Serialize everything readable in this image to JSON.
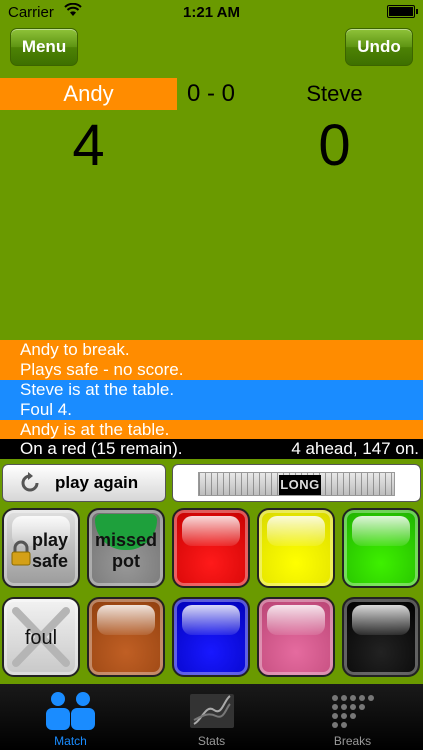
{
  "status": {
    "carrier": "Carrier",
    "time": "1:21 AM"
  },
  "nav": {
    "menu": "Menu",
    "undo": "Undo"
  },
  "players": {
    "left": {
      "name": "Andy",
      "score": "4"
    },
    "right": {
      "name": "Steve",
      "score": "0"
    },
    "frames": "0 - 0"
  },
  "log": [
    {
      "text": "Andy to break.",
      "color": "orange"
    },
    {
      "text": "Plays safe - no score.",
      "color": "orange"
    },
    {
      "text": "Steve is at the table.",
      "color": "blue"
    },
    {
      "text": "Foul 4.",
      "color": "blue"
    },
    {
      "text": "Andy is at the table.",
      "color": "orange"
    }
  ],
  "status_line": {
    "left": "On a red (15 remain).",
    "right": "4 ahead, 147 on."
  },
  "controls": {
    "play_again": "play again",
    "shot_length": "LONG"
  },
  "buttons": {
    "play_safe_line1": "play",
    "play_safe_line2": "safe",
    "missed_pot_line1": "missed",
    "missed_pot_line2": "pot",
    "foul": "foul"
  },
  "balls": [
    "red",
    "yellow",
    "green",
    "brown",
    "blue",
    "pink",
    "black"
  ],
  "tabs": {
    "match": "Match",
    "stats": "Stats",
    "breaks": "Breaks"
  },
  "colors": {
    "background": "#6a9a00",
    "orange": "#ff8c00",
    "blue": "#1a8cff",
    "accent": "#1a8cff"
  }
}
